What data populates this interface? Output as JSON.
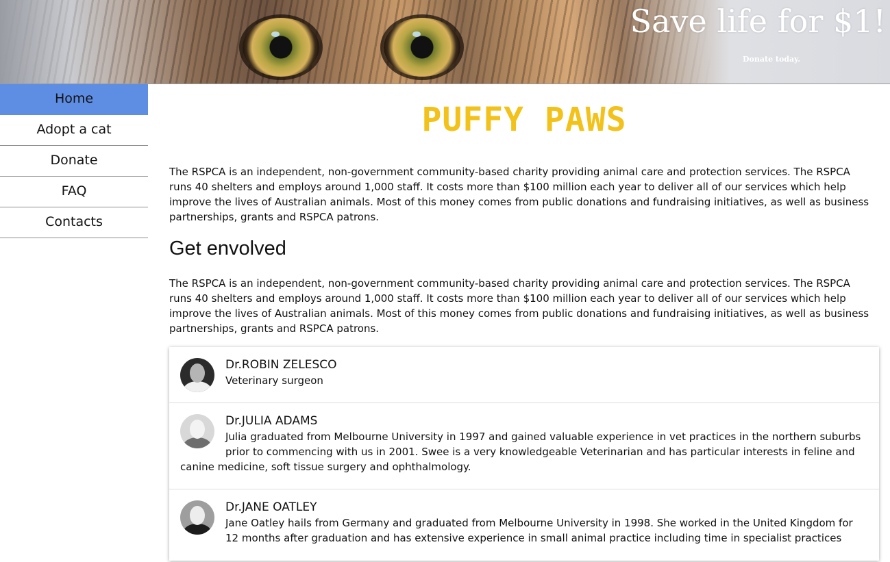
{
  "banner": {
    "title": "Save life for $1!",
    "subtitle": "Donate today."
  },
  "nav": {
    "items": [
      {
        "label": "Home",
        "active": true
      },
      {
        "label": "Adopt a cat"
      },
      {
        "label": "Donate"
      },
      {
        "label": "FAQ"
      },
      {
        "label": "Contacts"
      }
    ]
  },
  "main": {
    "site_title": "PUFFY PAWS",
    "intro": "The RSPCA is an independent, non-government community-based charity providing animal care and protection services. The RSPCA runs 40 shelters and employs around 1,000 staff. It costs more than $100 million each year to deliver all of our services which help improve the lives of Australian animals. Most of this money comes from public donations and fundraising initiatives, as well as business partnerships, grants and RSPCA patrons.",
    "section_title": "Get envolved",
    "section_text": "The RSPCA is an independent, non-government community-based charity providing animal care and protection services. The RSPCA runs 40 shelters and employs around 1,000 staff. It costs more than $100 million each year to deliver all of our services which help improve the lives of Australian animals. Most of this money comes from public donations and fundraising initiatives, as well as business partnerships, grants and RSPCA patrons."
  },
  "staff": [
    {
      "name": "Dr.ROBIN ZELESCO",
      "description": "Veterinary surgeon"
    },
    {
      "name": "Dr.JULIA ADAMS",
      "description": "Julia graduated from Melbourne University in 1997 and gained valuable experience in vet practices in the northern suburbs prior to commencing with us in 2001. Swee is a very knowledgeable Veterinarian and has particular interests in feline and canine medicine, soft tissue surgery and ophthalmology."
    },
    {
      "name": "Dr.JANE OATLEY",
      "description": "Jane Oatley hails from Germany and graduated from Melbourne University in 1998. She worked in the United Kingdom for 12 months after graduation and has extensive experience in small animal practice including time in specialist practices"
    }
  ]
}
